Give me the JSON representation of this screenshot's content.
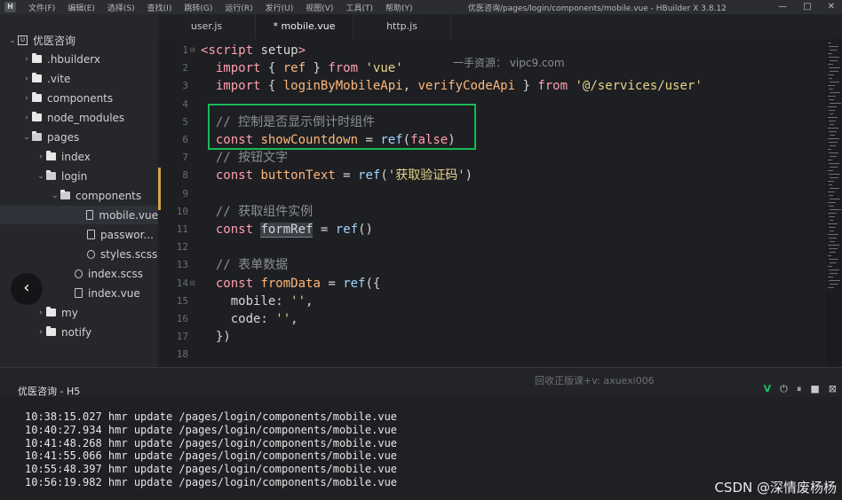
{
  "titlebar": {
    "logo": "H",
    "menu": [
      "文件(F)",
      "编辑(E)",
      "选择(S)",
      "查找(I)",
      "跳转(G)",
      "运行(R)",
      "发行(U)",
      "视图(V)",
      "工具(T)",
      "帮助(Y)"
    ],
    "window_title": "优医咨询/pages/login/components/mobile.vue - HBuilder X 3.8.12",
    "controls": [
      "—",
      "□",
      "✕"
    ]
  },
  "sidebar": {
    "project": "优医咨询",
    "items": [
      {
        "label": ".hbuilderx",
        "icon": "folder-icon",
        "arrow": "›"
      },
      {
        "label": ".vite",
        "icon": "folder-icon",
        "arrow": "›"
      },
      {
        "label": "components",
        "icon": "folder-icon",
        "arrow": "›"
      },
      {
        "label": "node_modules",
        "icon": "folder-icon",
        "arrow": "›"
      },
      {
        "label": "pages",
        "icon": "folder-open-icon",
        "arrow": "⌄"
      },
      {
        "label": "index",
        "icon": "folder-icon",
        "arrow": "›"
      },
      {
        "label": "login",
        "icon": "folder-open-icon",
        "arrow": "⌄"
      },
      {
        "label": "components",
        "icon": "folder-open-icon",
        "arrow": "⌄"
      },
      {
        "label": "mobile.vue",
        "icon": "vue-file-icon",
        "arrow": ""
      },
      {
        "label": "passwor...",
        "icon": "vue-file-icon",
        "arrow": ""
      },
      {
        "label": "styles.scss",
        "icon": "scss-file-icon",
        "arrow": ""
      },
      {
        "label": "index.scss",
        "icon": "scss-file-icon",
        "arrow": ""
      },
      {
        "label": "index.vue",
        "icon": "vue-file-icon",
        "arrow": ""
      },
      {
        "label": "my",
        "icon": "folder-icon",
        "arrow": "›"
      },
      {
        "label": "notify",
        "icon": "folder-icon",
        "arrow": "›"
      }
    ],
    "back_glyph": "‹",
    "bottom_icons": [
      "▤",
      "⚇",
      "☼",
      "↻",
      "☺"
    ]
  },
  "tabs": [
    {
      "label": "user.js",
      "active": false
    },
    {
      "label": "* mobile.vue",
      "active": true
    },
    {
      "label": "http.js",
      "active": false
    }
  ],
  "editor": {
    "watermark": "一手资源： vipc9.com",
    "line_numbers": [
      "1",
      "2",
      "3",
      "4",
      "5",
      "6",
      "7",
      "8",
      "9",
      "10",
      "11",
      "12",
      "13",
      "14",
      "15",
      "16",
      "17",
      "18"
    ],
    "lines": [
      [
        {
          "t": "<",
          "c": "tag"
        },
        {
          "t": "script",
          "c": "tag"
        },
        {
          "t": " setup",
          "c": "plain"
        },
        {
          "t": ">",
          "c": "tag"
        }
      ],
      [
        {
          "t": "  ",
          "c": "plain"
        },
        {
          "t": "import",
          "c": "kw"
        },
        {
          "t": " { ",
          "c": "plain"
        },
        {
          "t": "ref",
          "c": "var"
        },
        {
          "t": " } ",
          "c": "plain"
        },
        {
          "t": "from",
          "c": "kw"
        },
        {
          "t": " ",
          "c": "plain"
        },
        {
          "t": "'vue'",
          "c": "str"
        }
      ],
      [
        {
          "t": "  ",
          "c": "plain"
        },
        {
          "t": "import",
          "c": "kw"
        },
        {
          "t": " { ",
          "c": "plain"
        },
        {
          "t": "loginByMobileApi",
          "c": "var"
        },
        {
          "t": ", ",
          "c": "plain"
        },
        {
          "t": "verifyCodeApi",
          "c": "var"
        },
        {
          "t": " } ",
          "c": "plain"
        },
        {
          "t": "from",
          "c": "kw"
        },
        {
          "t": " ",
          "c": "plain"
        },
        {
          "t": "'@/services/user'",
          "c": "str"
        }
      ],
      [],
      [
        {
          "t": "  // 控制是否显示倒计时组件",
          "c": "cmt"
        }
      ],
      [
        {
          "t": "  ",
          "c": "plain"
        },
        {
          "t": "const",
          "c": "kw"
        },
        {
          "t": " ",
          "c": "plain"
        },
        {
          "t": "showCountdown",
          "c": "var"
        },
        {
          "t": " = ",
          "c": "plain"
        },
        {
          "t": "ref",
          "c": "fn"
        },
        {
          "t": "(",
          "c": "plain"
        },
        {
          "t": "false",
          "c": "kw"
        },
        {
          "t": ")",
          "c": "plain"
        }
      ],
      [
        {
          "t": "  // 按钮文字",
          "c": "cmt"
        }
      ],
      [
        {
          "t": "  ",
          "c": "plain"
        },
        {
          "t": "const",
          "c": "kw"
        },
        {
          "t": " ",
          "c": "plain"
        },
        {
          "t": "buttonText",
          "c": "var"
        },
        {
          "t": " = ",
          "c": "plain"
        },
        {
          "t": "ref",
          "c": "fn"
        },
        {
          "t": "(",
          "c": "plain"
        },
        {
          "t": "'获取验证码'",
          "c": "str"
        },
        {
          "t": ")",
          "c": "plain"
        }
      ],
      [],
      [
        {
          "t": "  // 获取组件实例",
          "c": "cmt"
        }
      ],
      [
        {
          "t": "  ",
          "c": "plain"
        },
        {
          "t": "const",
          "c": "kw"
        },
        {
          "t": " ",
          "c": "plain"
        },
        {
          "t": "formRef",
          "c": "hl"
        },
        {
          "t": " = ",
          "c": "plain"
        },
        {
          "t": "ref",
          "c": "fn"
        },
        {
          "t": "()",
          "c": "plain"
        }
      ],
      [],
      [
        {
          "t": "  // 表单数据",
          "c": "cmt"
        }
      ],
      [
        {
          "t": "  ",
          "c": "plain"
        },
        {
          "t": "const",
          "c": "kw"
        },
        {
          "t": " ",
          "c": "plain"
        },
        {
          "t": "fromData",
          "c": "var"
        },
        {
          "t": " = ",
          "c": "plain"
        },
        {
          "t": "ref",
          "c": "fn"
        },
        {
          "t": "({",
          "c": "plain"
        }
      ],
      [
        {
          "t": "    mobile: ",
          "c": "plain"
        },
        {
          "t": "''",
          "c": "str"
        },
        {
          "t": ",",
          "c": "plain"
        }
      ],
      [
        {
          "t": "    code: ",
          "c": "plain"
        },
        {
          "t": "''",
          "c": "str"
        },
        {
          "t": ",",
          "c": "plain"
        }
      ],
      [
        {
          "t": "  })",
          "c": "plain"
        }
      ],
      []
    ]
  },
  "console": {
    "tab_label": "优医咨询 - H5",
    "watermark": "回收正版课+v: axuexi006",
    "icons": [
      "V",
      "⏻",
      "⏸",
      "■",
      "⊠"
    ],
    "logs": [
      "10:38:15.027 hmr update /pages/login/components/mobile.vue",
      "10:40:27.934 hmr update /pages/login/components/mobile.vue",
      "10:41:48.268 hmr update /pages/login/components/mobile.vue",
      "10:41:55.066 hmr update /pages/login/components/mobile.vue",
      "10:55:48.397 hmr update /pages/login/components/mobile.vue",
      "10:56:19.982 hmr update /pages/login/components/mobile.vue"
    ]
  },
  "watermark_csdn": "CSDN @深情废杨杨",
  "colors": {
    "highlight_box": "#17b857",
    "keyword": "#ff9fb0",
    "string": "#e6d28a",
    "comment": "#8c8f94",
    "variable": "#ffb87a"
  }
}
